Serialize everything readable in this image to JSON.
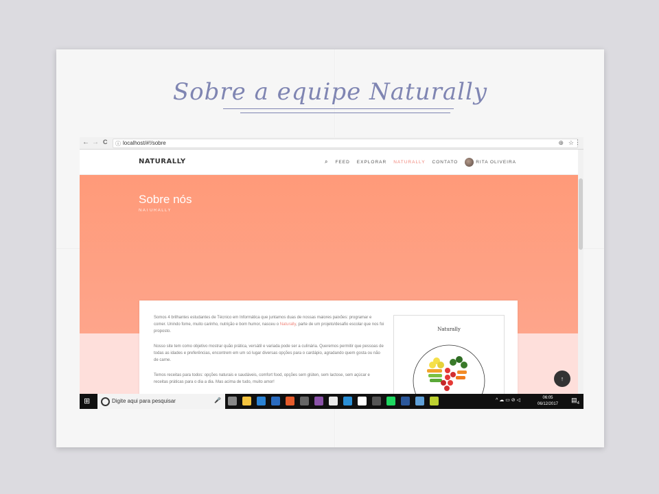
{
  "caption": "Sobre a equipe Naturally",
  "browser": {
    "url": "localhost/#!/sobre",
    "back_icon": "←",
    "forward_icon": "→",
    "reload_icon": "C",
    "zoom_icon": "⊕",
    "star_icon": "☆",
    "menu_icon": "⋮"
  },
  "site": {
    "logo": "NATURALLY",
    "nav": {
      "search_icon": "⌕",
      "items": [
        "FEED",
        "EXPLORAR",
        "NATURALLY",
        "CONTATO"
      ],
      "active_index": 2,
      "user": "RITA OLIVEIRA"
    },
    "hero": {
      "title": "Sobre nós",
      "subtitle": "NATURALLY"
    },
    "about": {
      "p1_before": "Somos 4 brilhantes estudantes de Técnico em Informática que juntamos duas de nossas maiores paixões: programar e comer. Unindo fome, muito carinho, nutrição e bom humor, nasceu o ",
      "p1_link": "Naturally",
      "p1_after": ", parte de um projeto/desafio escolar que nos foi proposto.",
      "p2": "Nosso site tem como objetivo mostrar quão prática, versátil e variada pode ser a culinária. Queremos permitir que pessoas de todas as idades e preferências, encontrem em um só lugar diversas opções para o cardápio, agradando quem gosta ou não de carne.",
      "p3": "Temos receitas para todos: opções naturais e saudáveis, comfort food, opções sem glúten, sem lactose, sem açúcar e receitas práticas para o dia a dia. Mas acima de tudo, muito amor!"
    },
    "image_card_title": "Naturally",
    "fab_icon": "↑"
  },
  "taskbar": {
    "start_icon": "⊞",
    "search_placeholder": "Digite aqui para pesquisar",
    "mic_icon": "🎤",
    "tray": "^ ☁ ▭ ⊘ ◁",
    "time": "06:05",
    "date": "06/12/2017",
    "notif_icon": "▤",
    "notif_count": "4",
    "app_colors": [
      "#888888",
      "#f3c33f",
      "#2a82d4",
      "#2a6bbf",
      "#e55b2b",
      "#666666",
      "#8a52a8",
      "#eaeaea",
      "#2a8fd6",
      "#ffffff",
      "#555555",
      "#1ed760",
      "#2b579a",
      "#5fa0d8",
      "#bcd030"
    ]
  }
}
